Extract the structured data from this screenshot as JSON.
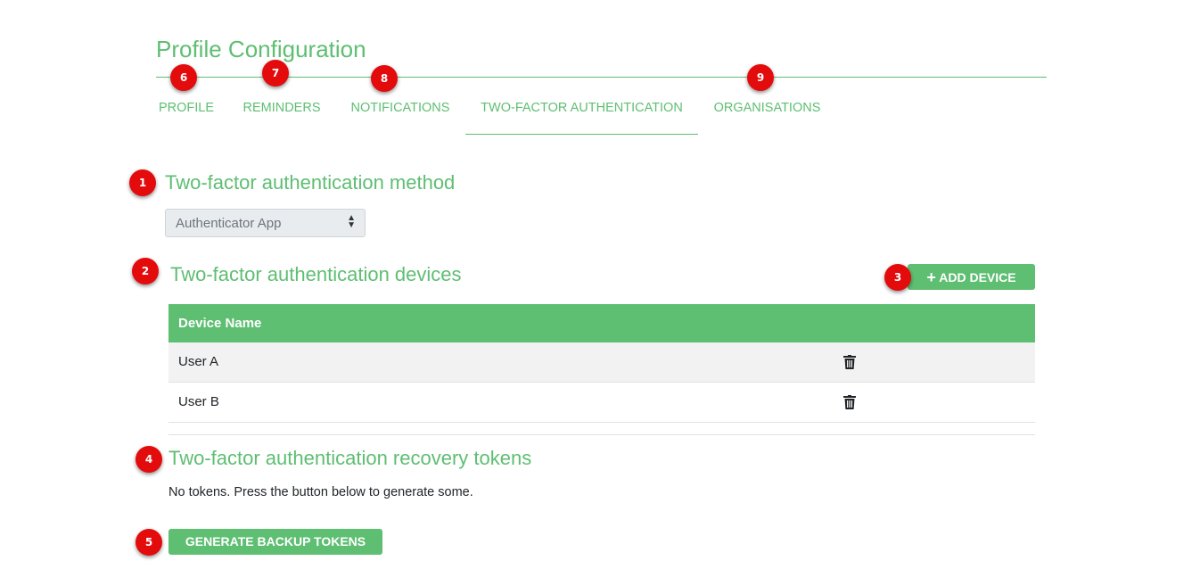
{
  "page": {
    "title": "Profile Configuration"
  },
  "tabs": [
    {
      "label": "PROFILE",
      "badge": "6"
    },
    {
      "label": "REMINDERS",
      "badge": "7"
    },
    {
      "label": "NOTIFICATIONS",
      "badge": "8"
    },
    {
      "label": "TWO-FACTOR AUTHENTICATION",
      "active": true
    },
    {
      "label": "ORGANISATIONS",
      "badge": "9"
    }
  ],
  "method": {
    "title": "Two-factor authentication method",
    "badge": "1",
    "selected": "Authenticator App"
  },
  "devices": {
    "title": "Two-factor authentication devices",
    "badge": "2",
    "add_button": {
      "icon": "plus-icon",
      "label": "ADD DEVICE",
      "badge": "3"
    },
    "column_header": "Device Name",
    "rows": [
      {
        "name": "User A",
        "action_icon": "trash-icon"
      },
      {
        "name": "User B",
        "action_icon": "trash-icon"
      }
    ]
  },
  "tokens": {
    "title": "Two-factor authentication recovery tokens",
    "badge": "4",
    "message": "No tokens. Press the button below to generate some.",
    "generate_button": {
      "label": "GENERATE BACKUP TOKENS",
      "badge": "5"
    }
  },
  "colors": {
    "accent": "#5ebe72",
    "badge": "#e30b0b",
    "row_stripe": "#f2f2f2"
  }
}
